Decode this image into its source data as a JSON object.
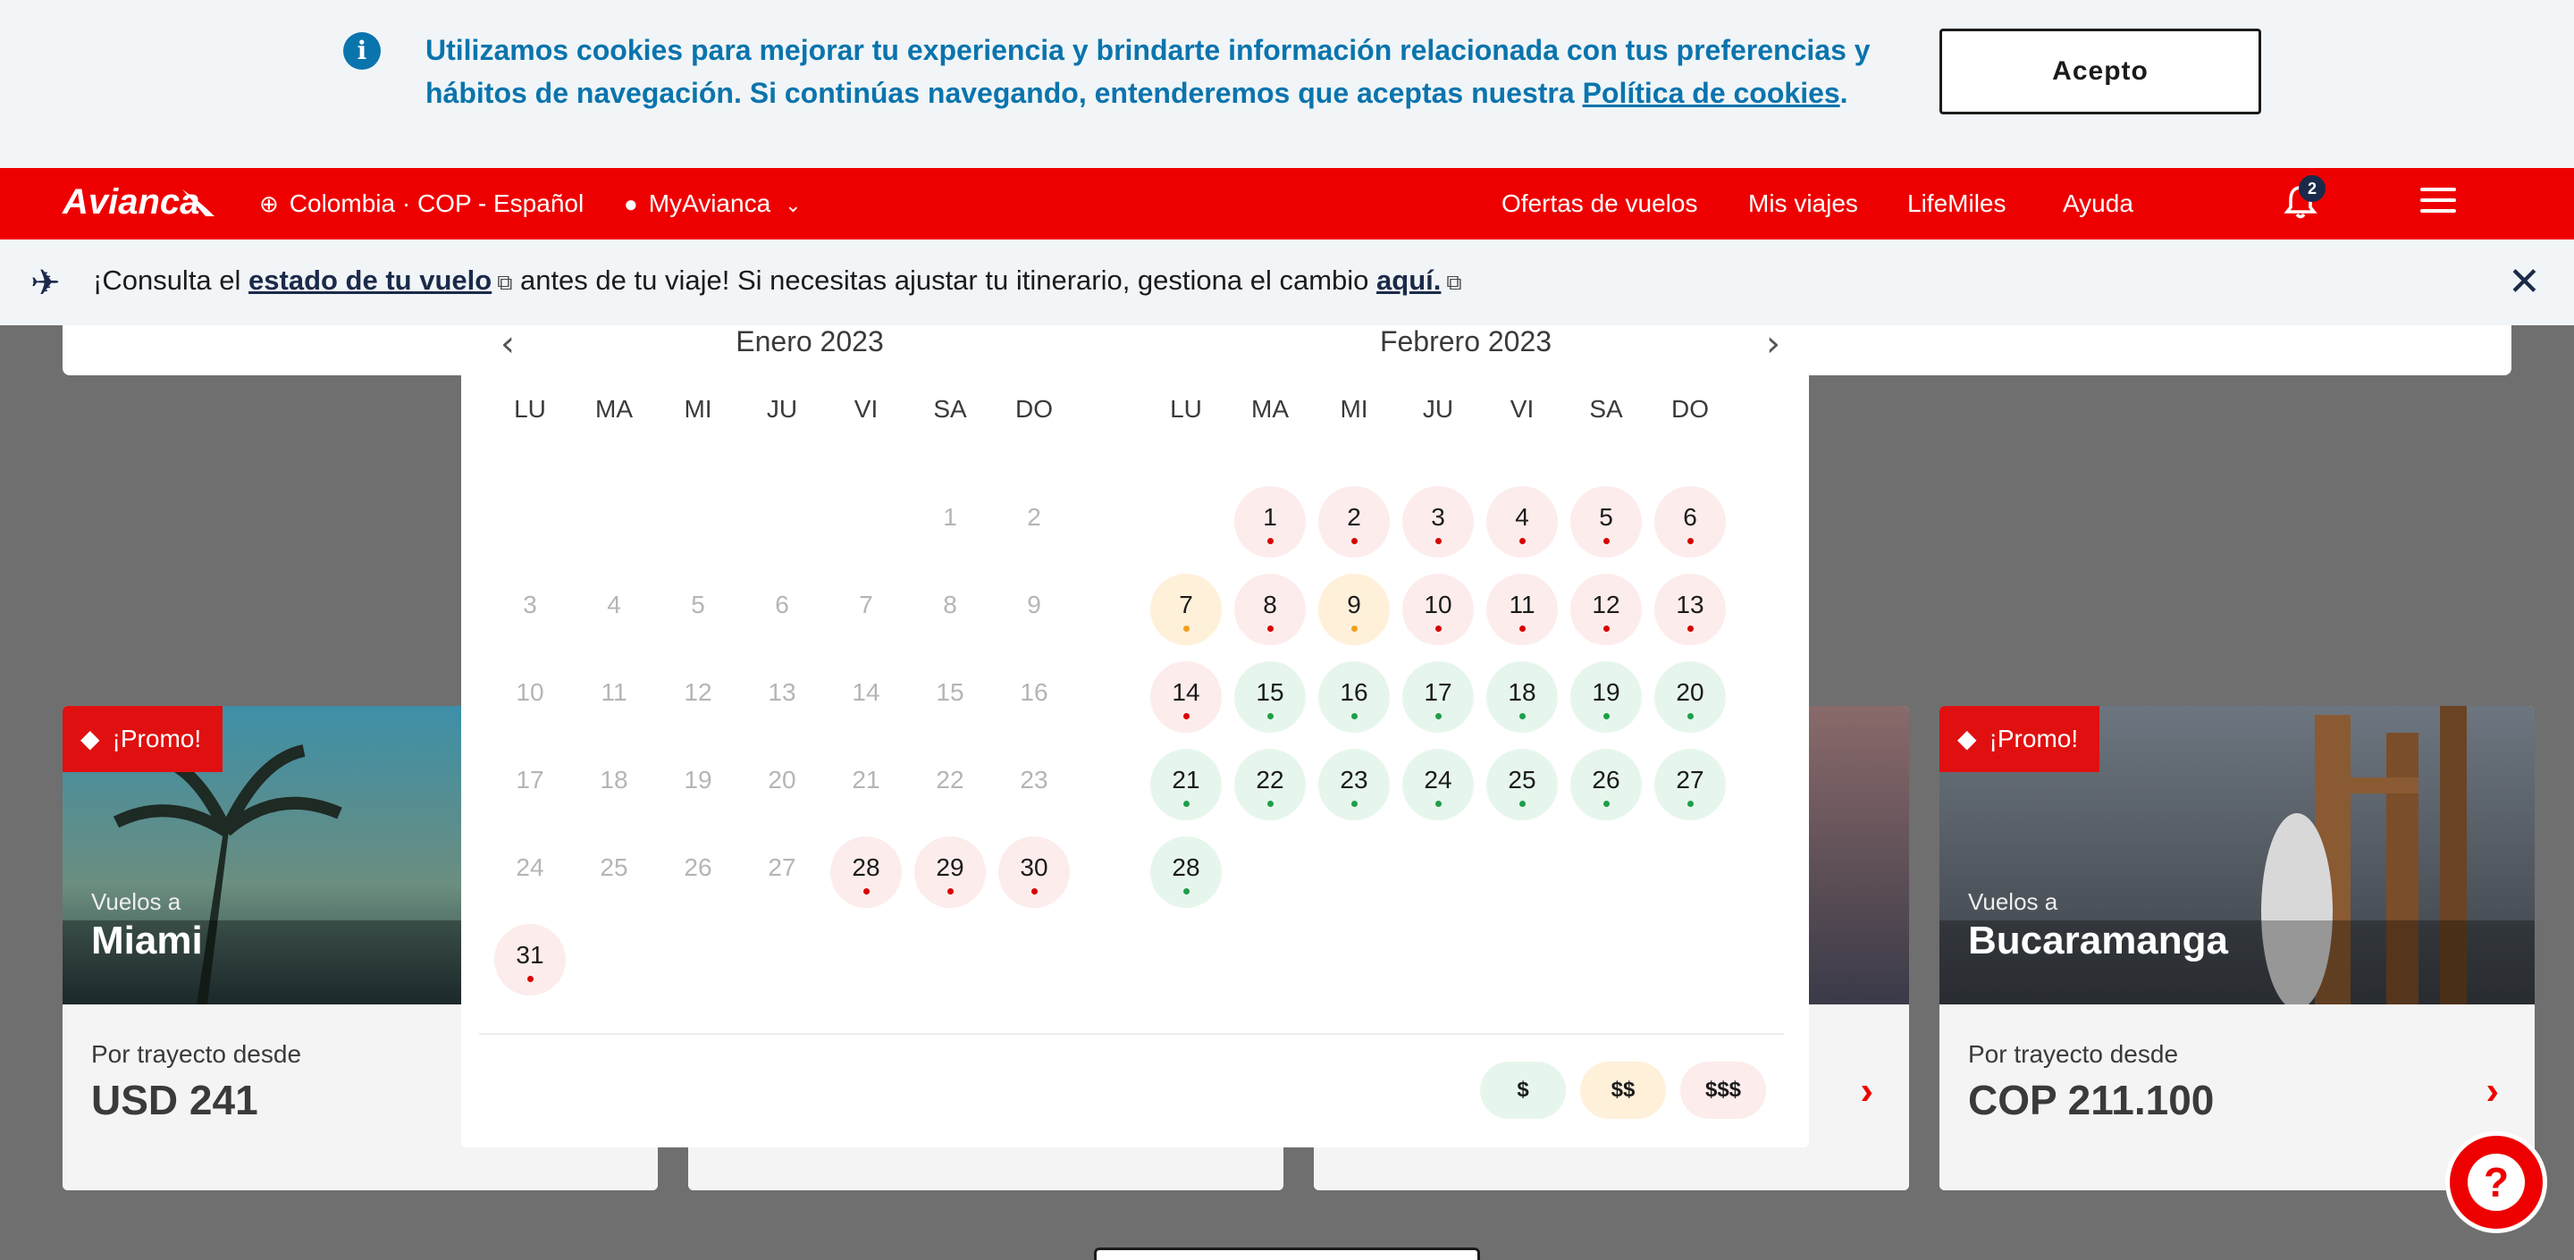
{
  "cookie": {
    "text_before": "Utilizamos cookies para mejorar tu experiencia y brindarte información relacionada con tus preferencias y hábitos de navegación. Si continúas navegando, entenderemos que aceptas nuestra ",
    "link": "Política de cookies",
    "text_after": ".",
    "accept": "Acepto",
    "icon": "info-icon"
  },
  "nav": {
    "logo": "Avianca",
    "region": "Colombia · COP - Español",
    "account": "MyAvianca",
    "links": [
      "Ofertas de vuelos",
      "Mis viajes",
      "LifeMiles",
      "Ayuda"
    ],
    "notifications": "2"
  },
  "strip": {
    "t1": "¡Consulta el ",
    "link1": "estado de tu vuelo",
    "t2": " antes de tu viaje! Si necesitas ajustar tu itinerario, gestiona el cambio ",
    "link2": "aquí."
  },
  "cards": [
    {
      "promo": "¡Promo!",
      "vuelos": "Vuelos a",
      "city": "Miami",
      "desde": "Por trayecto desde",
      "price": "USD 241"
    },
    {
      "promo": "¡Promo!",
      "vuelos": "Vuelos a",
      "city": "Bucaramanga",
      "desde": "Por trayecto desde",
      "price": "COP 211.100"
    }
  ],
  "calendar": {
    "weekdays": [
      "LU",
      "MA",
      "MI",
      "JU",
      "VI",
      "SA",
      "DO"
    ],
    "months": [
      {
        "title": "Enero 2023",
        "first_weekday": 6,
        "days": 31,
        "prices": {
          "28": "high",
          "29": "high",
          "30": "high",
          "31": "high"
        }
      },
      {
        "title": "Febrero 2023",
        "first_weekday": 2,
        "days": 28,
        "prices": {
          "1": "high",
          "2": "high",
          "3": "high",
          "4": "high",
          "5": "high",
          "6": "high",
          "7": "mid",
          "8": "high",
          "9": "mid",
          "10": "high",
          "11": "high",
          "12": "high",
          "13": "high",
          "14": "high",
          "15": "low",
          "16": "low",
          "17": "low",
          "18": "low",
          "19": "low",
          "20": "low",
          "21": "low",
          "22": "low",
          "23": "low",
          "24": "low",
          "25": "low",
          "26": "low",
          "27": "low",
          "28": "low"
        }
      }
    ],
    "legend": [
      "$",
      "$$",
      "$$$"
    ],
    "colors": {
      "low": "#e7f6ec",
      "mid": "#fff0d9",
      "high": "#fdecec"
    }
  }
}
